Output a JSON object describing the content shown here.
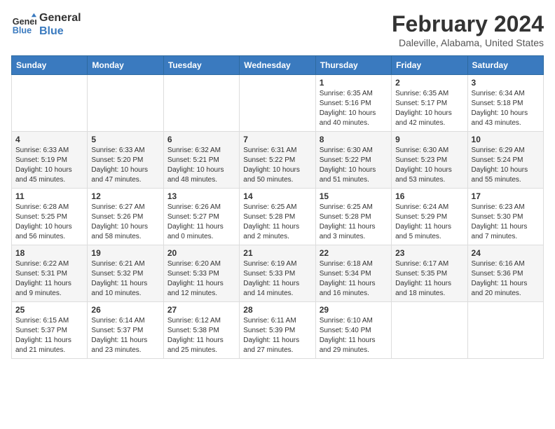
{
  "header": {
    "logo_line1": "General",
    "logo_line2": "Blue",
    "month": "February 2024",
    "location": "Daleville, Alabama, United States"
  },
  "days_of_week": [
    "Sunday",
    "Monday",
    "Tuesday",
    "Wednesday",
    "Thursday",
    "Friday",
    "Saturday"
  ],
  "weeks": [
    [
      {
        "day": "",
        "info": ""
      },
      {
        "day": "",
        "info": ""
      },
      {
        "day": "",
        "info": ""
      },
      {
        "day": "",
        "info": ""
      },
      {
        "day": "1",
        "info": "Sunrise: 6:35 AM\nSunset: 5:16 PM\nDaylight: 10 hours\nand 40 minutes."
      },
      {
        "day": "2",
        "info": "Sunrise: 6:35 AM\nSunset: 5:17 PM\nDaylight: 10 hours\nand 42 minutes."
      },
      {
        "day": "3",
        "info": "Sunrise: 6:34 AM\nSunset: 5:18 PM\nDaylight: 10 hours\nand 43 minutes."
      }
    ],
    [
      {
        "day": "4",
        "info": "Sunrise: 6:33 AM\nSunset: 5:19 PM\nDaylight: 10 hours\nand 45 minutes."
      },
      {
        "day": "5",
        "info": "Sunrise: 6:33 AM\nSunset: 5:20 PM\nDaylight: 10 hours\nand 47 minutes."
      },
      {
        "day": "6",
        "info": "Sunrise: 6:32 AM\nSunset: 5:21 PM\nDaylight: 10 hours\nand 48 minutes."
      },
      {
        "day": "7",
        "info": "Sunrise: 6:31 AM\nSunset: 5:22 PM\nDaylight: 10 hours\nand 50 minutes."
      },
      {
        "day": "8",
        "info": "Sunrise: 6:30 AM\nSunset: 5:22 PM\nDaylight: 10 hours\nand 51 minutes."
      },
      {
        "day": "9",
        "info": "Sunrise: 6:30 AM\nSunset: 5:23 PM\nDaylight: 10 hours\nand 53 minutes."
      },
      {
        "day": "10",
        "info": "Sunrise: 6:29 AM\nSunset: 5:24 PM\nDaylight: 10 hours\nand 55 minutes."
      }
    ],
    [
      {
        "day": "11",
        "info": "Sunrise: 6:28 AM\nSunset: 5:25 PM\nDaylight: 10 hours\nand 56 minutes."
      },
      {
        "day": "12",
        "info": "Sunrise: 6:27 AM\nSunset: 5:26 PM\nDaylight: 10 hours\nand 58 minutes."
      },
      {
        "day": "13",
        "info": "Sunrise: 6:26 AM\nSunset: 5:27 PM\nDaylight: 11 hours\nand 0 minutes."
      },
      {
        "day": "14",
        "info": "Sunrise: 6:25 AM\nSunset: 5:28 PM\nDaylight: 11 hours\nand 2 minutes."
      },
      {
        "day": "15",
        "info": "Sunrise: 6:25 AM\nSunset: 5:28 PM\nDaylight: 11 hours\nand 3 minutes."
      },
      {
        "day": "16",
        "info": "Sunrise: 6:24 AM\nSunset: 5:29 PM\nDaylight: 11 hours\nand 5 minutes."
      },
      {
        "day": "17",
        "info": "Sunrise: 6:23 AM\nSunset: 5:30 PM\nDaylight: 11 hours\nand 7 minutes."
      }
    ],
    [
      {
        "day": "18",
        "info": "Sunrise: 6:22 AM\nSunset: 5:31 PM\nDaylight: 11 hours\nand 9 minutes."
      },
      {
        "day": "19",
        "info": "Sunrise: 6:21 AM\nSunset: 5:32 PM\nDaylight: 11 hours\nand 10 minutes."
      },
      {
        "day": "20",
        "info": "Sunrise: 6:20 AM\nSunset: 5:33 PM\nDaylight: 11 hours\nand 12 minutes."
      },
      {
        "day": "21",
        "info": "Sunrise: 6:19 AM\nSunset: 5:33 PM\nDaylight: 11 hours\nand 14 minutes."
      },
      {
        "day": "22",
        "info": "Sunrise: 6:18 AM\nSunset: 5:34 PM\nDaylight: 11 hours\nand 16 minutes."
      },
      {
        "day": "23",
        "info": "Sunrise: 6:17 AM\nSunset: 5:35 PM\nDaylight: 11 hours\nand 18 minutes."
      },
      {
        "day": "24",
        "info": "Sunrise: 6:16 AM\nSunset: 5:36 PM\nDaylight: 11 hours\nand 20 minutes."
      }
    ],
    [
      {
        "day": "25",
        "info": "Sunrise: 6:15 AM\nSunset: 5:37 PM\nDaylight: 11 hours\nand 21 minutes."
      },
      {
        "day": "26",
        "info": "Sunrise: 6:14 AM\nSunset: 5:37 PM\nDaylight: 11 hours\nand 23 minutes."
      },
      {
        "day": "27",
        "info": "Sunrise: 6:12 AM\nSunset: 5:38 PM\nDaylight: 11 hours\nand 25 minutes."
      },
      {
        "day": "28",
        "info": "Sunrise: 6:11 AM\nSunset: 5:39 PM\nDaylight: 11 hours\nand 27 minutes."
      },
      {
        "day": "29",
        "info": "Sunrise: 6:10 AM\nSunset: 5:40 PM\nDaylight: 11 hours\nand 29 minutes."
      },
      {
        "day": "",
        "info": ""
      },
      {
        "day": "",
        "info": ""
      }
    ]
  ]
}
